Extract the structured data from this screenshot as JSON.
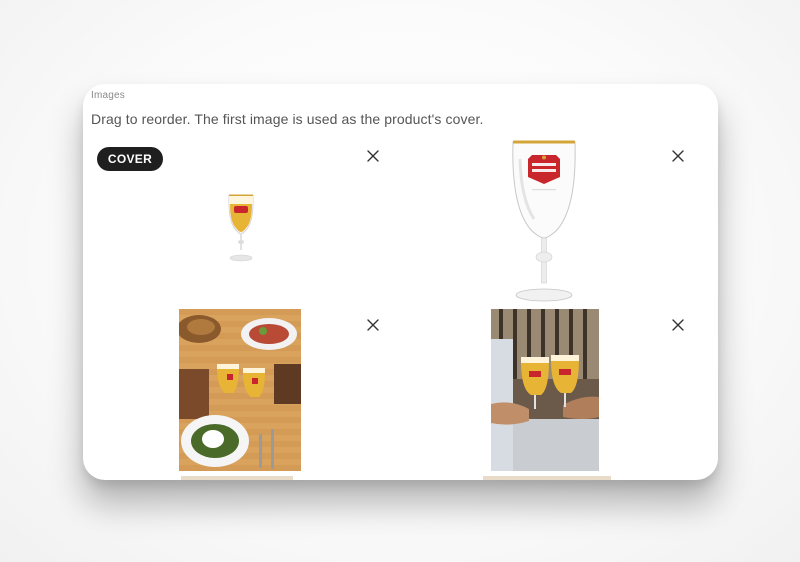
{
  "section": {
    "label": "Images",
    "helper": "Drag to reorder. The first image is used as the product's cover."
  },
  "cover_badge": "COVER",
  "images": [
    {
      "alt": "Stella Artois chalice with beer"
    },
    {
      "alt": "Empty Stella Artois chalice"
    },
    {
      "alt": "Toasting with beer over food on table"
    },
    {
      "alt": "Two chalices clinking outdoors"
    }
  ],
  "colors": {
    "badge_bg": "#1f1f1f",
    "beer": "#e8b436",
    "glass_rim": "#d4a437",
    "label_red": "#c8262c"
  },
  "icons": {
    "remove": "close-icon"
  }
}
